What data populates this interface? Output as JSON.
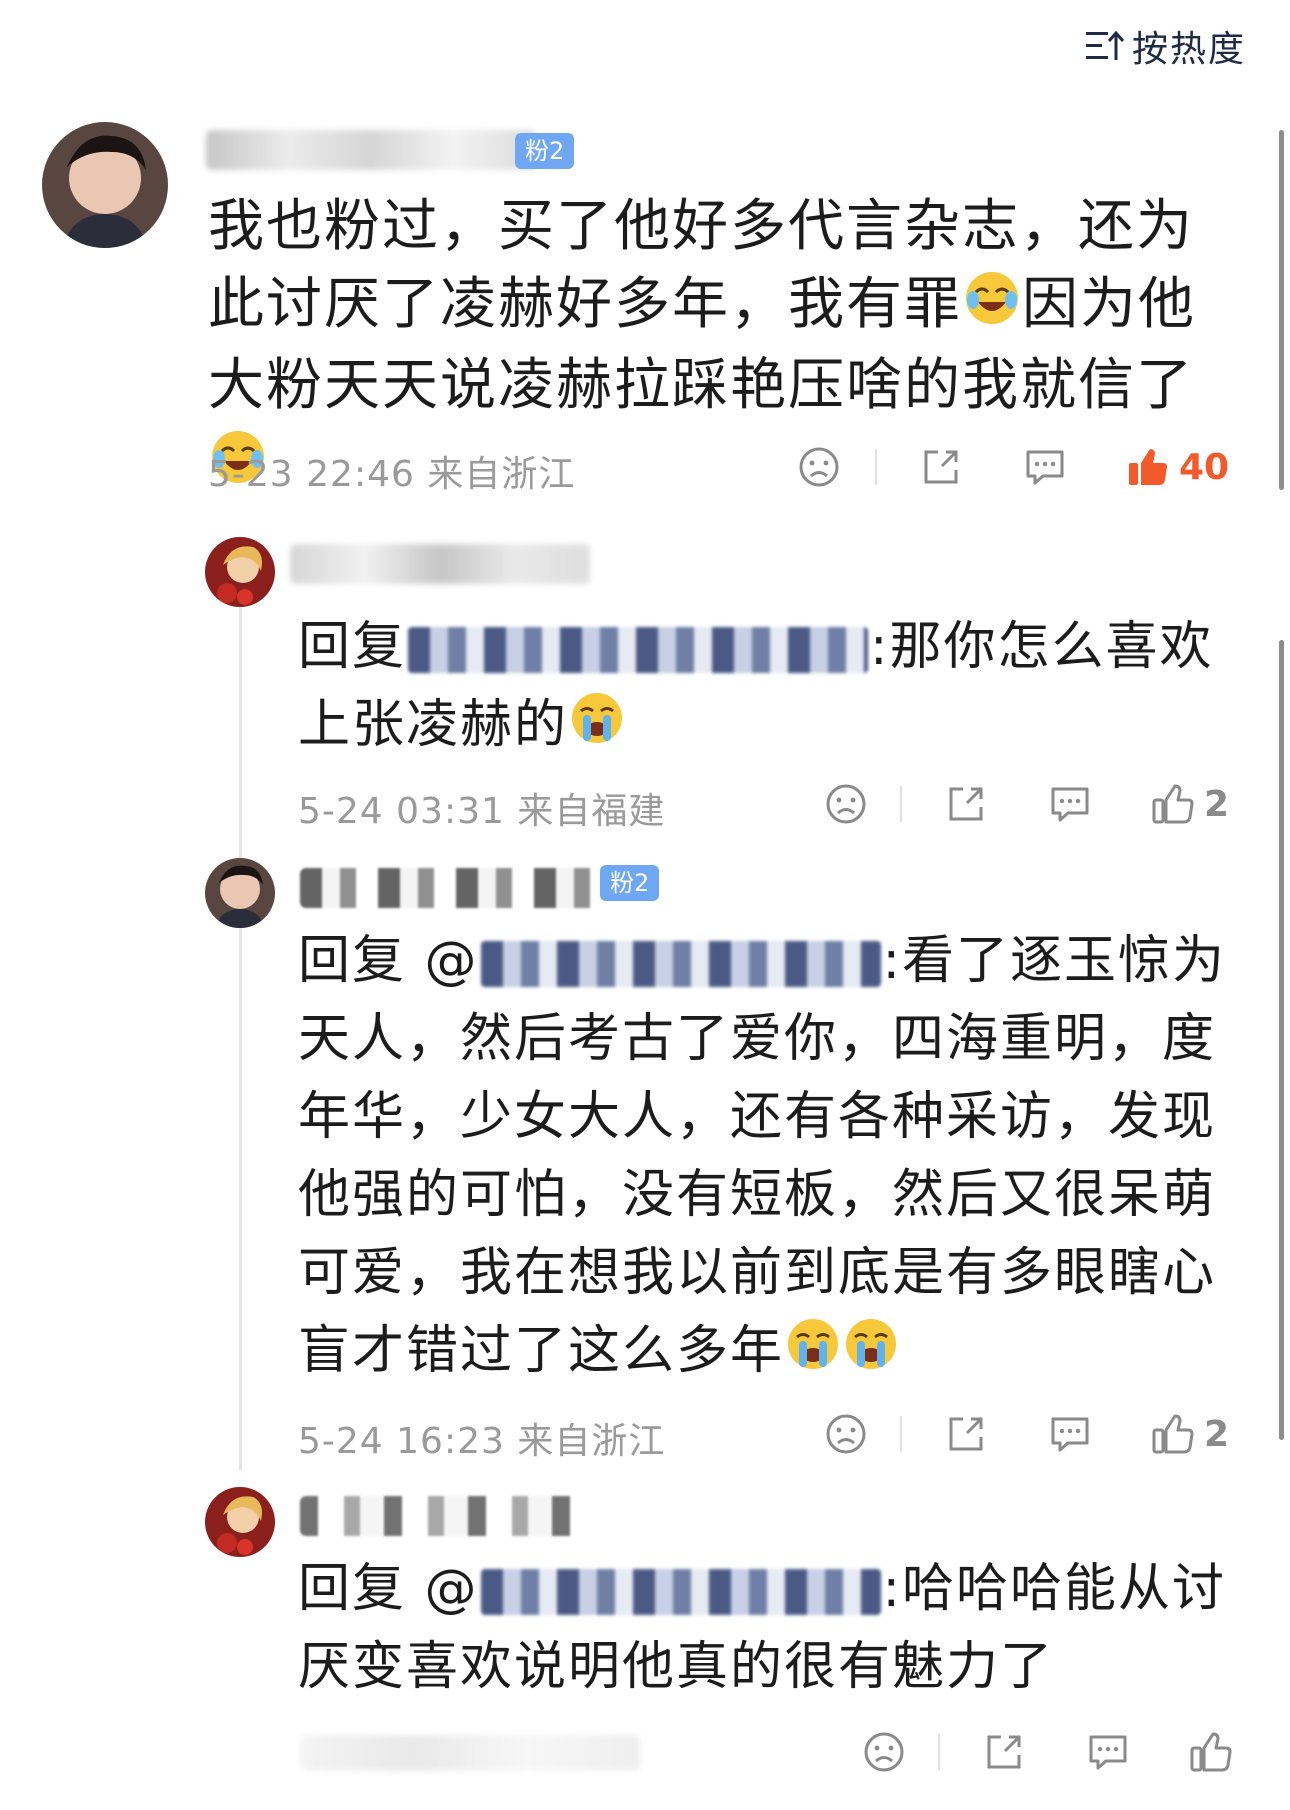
{
  "toolbar": {
    "sort_label": "按热度"
  },
  "comments": [
    {
      "badge": "粉2",
      "text_parts": [
        "我也粉过，买了他好多代言杂志，还为此讨厌了凌赫好多年，我有罪",
        "因为他大粉天天说凌赫拉踩艳压啥的我就信了"
      ],
      "time": "5-23 22:46",
      "location": "来自浙江",
      "likes": "40",
      "liked": true,
      "emoji": "laugh-cry-emoji"
    },
    {
      "reply_prefix": "回复",
      "text_parts": [
        ":那你怎么喜欢上张凌赫的"
      ],
      "time": "5-24 03:31",
      "location": "来自福建",
      "likes": "2",
      "emoji": "crying-emoji"
    },
    {
      "badge": "粉2",
      "reply_prefix": "回复 @",
      "text_parts": [
        ":看了逐玉惊为天人，然后考古了爱你，四海重明，度年华，少女大人，还有各种采访，发现他强的可怕，没有短板，然后又很呆萌可爱，我在想我以前到底是有多眼瞎心盲才错过了这么多年"
      ],
      "time": "5-24 16:23",
      "location": "来自浙江",
      "likes": "2",
      "emoji": "crying-emoji"
    },
    {
      "reply_prefix": "回复 @",
      "text_parts": [
        ":哈哈哈能从讨厌变喜欢说明他真的很有魅力了"
      ]
    }
  ],
  "icons": [
    "sort-icon",
    "dislike-face-icon",
    "share-icon",
    "comment-icon",
    "thumbs-up-icon"
  ],
  "colors": {
    "like_active": "#f25a2b",
    "meta_text": "#9a9a9a",
    "badge": "#6fa7f2",
    "icon": "#8a8a8a",
    "sort_text": "#1f2a44"
  }
}
